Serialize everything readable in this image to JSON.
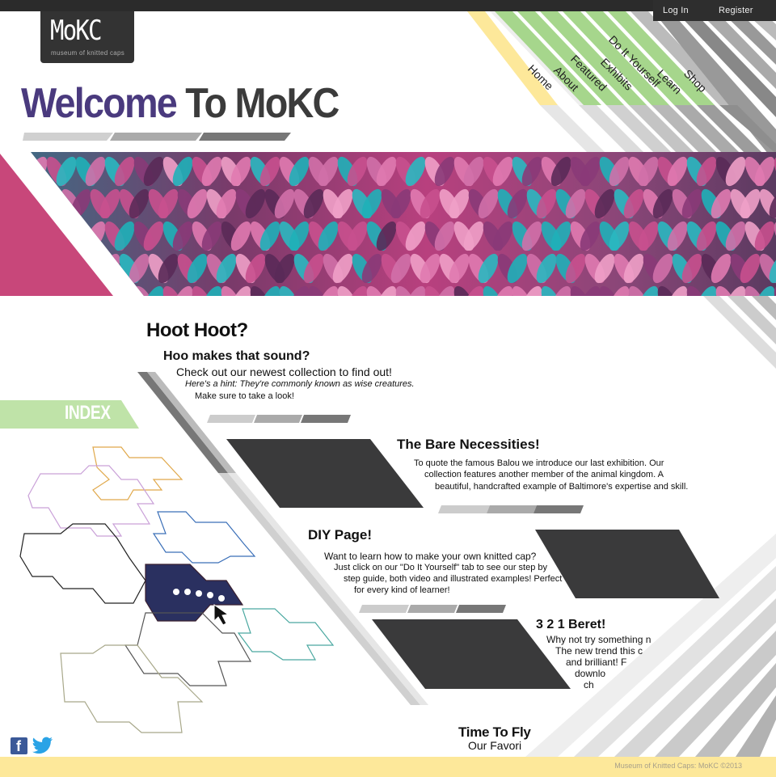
{
  "auth": {
    "login": "Log In",
    "register": "Register"
  },
  "logo": {
    "title": "MoKC",
    "subtitle": "museum of knitted caps"
  },
  "header": {
    "welcome_a": "Welcome",
    "welcome_b": "To MoKC"
  },
  "nav": {
    "items": [
      "Home",
      "About",
      "Featured",
      "Exhibits",
      "Do It Yourself",
      "Learn",
      "Shop"
    ]
  },
  "hero": {
    "image": "knitted-yarn-photo"
  },
  "index": {
    "label": "INDEX"
  },
  "sections": {
    "hoot": {
      "title": "Hoot Hoot?",
      "subtitle": "Hoo makes that sound?",
      "line1": "Check out our newest collection to find out!",
      "line2": "Here's a hint:  They're commonly known as wise creatures.",
      "line3": "Make sure to take a look!"
    },
    "bare": {
      "title": "The Bare Necessities!",
      "line1": "To quote the famous Balou we introduce our last exhibition.  Our",
      "line2": "collection features another member of the animal kingdom. A",
      "line3": "beautiful, handcrafted example of Baltimore's  expertise and skill."
    },
    "diy": {
      "title": "DIY Page!",
      "line1": "Want to learn how to make your own knitted cap?",
      "line2": "Just click on our \"Do It Yourself\" tab to see our step by",
      "line3": "step guide, both video and illustrated  examples! Perfect",
      "line4": "for every kind of learner!"
    },
    "beret": {
      "title": "3 2 1 Beret!",
      "line1": "Why not try something n",
      "line2": "The new trend this c",
      "line3": "and brilliant! F",
      "line4": "downlo",
      "line5": "ch"
    },
    "fly": {
      "title": "Time To Fly",
      "line1": "Our Favori"
    }
  },
  "social": {
    "facebook": "facebook-icon",
    "twitter": "twitter-icon"
  },
  "footer": {
    "copyright": "Museum of Knitted Caps: MoKC ©2013"
  },
  "colors": {
    "purple": "#4a3a7e",
    "magenta": "#c8477a",
    "green": "#a6d68c",
    "yellow": "#fde89a",
    "dark": "#3a3a3b"
  }
}
